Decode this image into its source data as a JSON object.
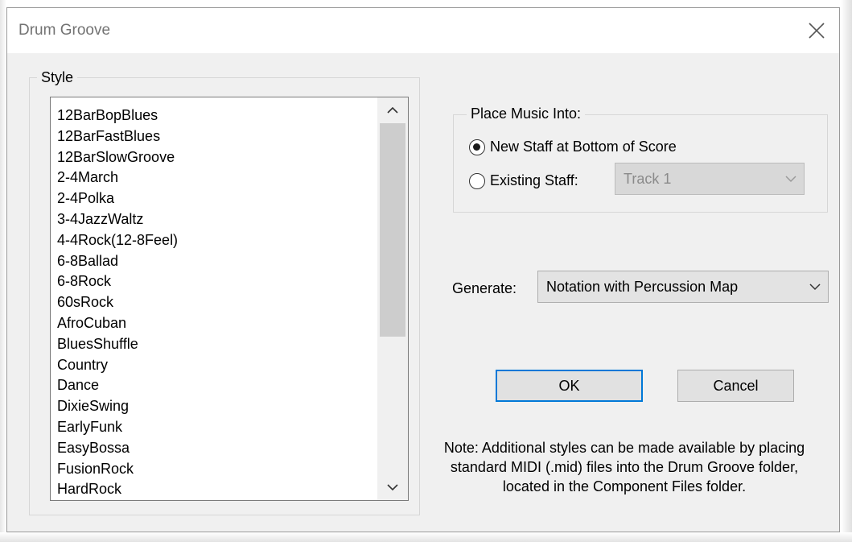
{
  "window": {
    "title": "Drum Groove",
    "close_icon": "close-icon"
  },
  "style_group": {
    "label": "Style",
    "items": [
      "12BarBopBlues",
      "12BarFastBlues",
      "12BarSlowGroove",
      "2-4March",
      "2-4Polka",
      "3-4JazzWaltz",
      "4-4Rock(12-8Feel)",
      "6-8Ballad",
      "6-8Rock",
      "60sRock",
      "AfroCuban",
      "BluesShuffle",
      "Country",
      "Dance",
      "DixieSwing",
      "EarlyFunk",
      "EasyBossa",
      "FusionRock",
      "HardRock"
    ],
    "scroll_up_icon": "chevron-up-icon",
    "scroll_down_icon": "chevron-down-icon"
  },
  "place_group": {
    "label": "Place Music Into:",
    "option_new": "New Staff at Bottom of Score",
    "option_existing": "Existing Staff:",
    "selected": "new",
    "existing_staff_value": "Track 1"
  },
  "generate": {
    "label": "Generate:",
    "value": "Notation with Percussion Map"
  },
  "buttons": {
    "ok": "OK",
    "cancel": "Cancel"
  },
  "note": "Note: Additional styles can be made available by placing standard MIDI (.mid) files into the Drum Groove folder, located in the Component Files folder.",
  "colors": {
    "dialog_bg": "#f0f0f0",
    "focus_border": "#0078d7"
  }
}
